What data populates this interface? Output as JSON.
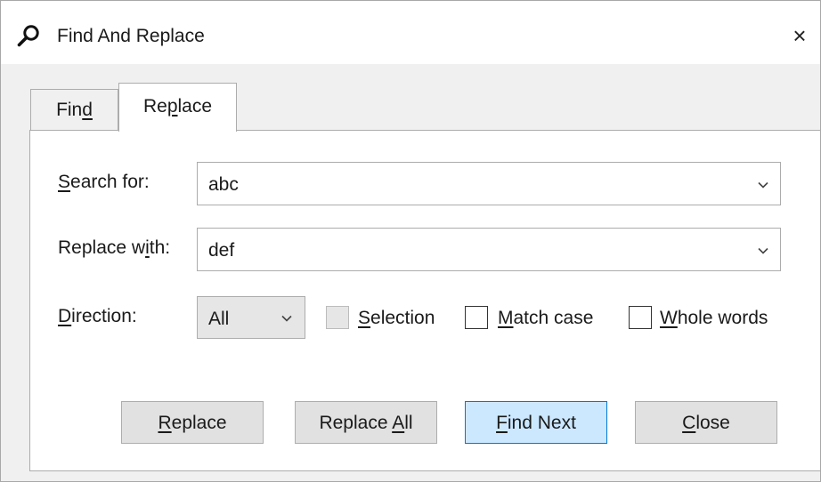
{
  "window": {
    "title": "Find And Replace",
    "close_glyph": "×",
    "title_icon": "search-icon"
  },
  "tabs": [
    {
      "label": "Find",
      "access_key_index": 3,
      "active": false
    },
    {
      "label": "Replace",
      "access_key_index": 2,
      "active": true
    }
  ],
  "form": {
    "search_label": "Search for:",
    "search_access_key_index": 0,
    "search_value": "abc",
    "replace_label": "Replace with:",
    "replace_access_key_index": 9,
    "replace_value": "def",
    "direction_label": "Direction:",
    "direction_access_key_index": 0,
    "direction_value": "All"
  },
  "options": [
    {
      "label": "Selection",
      "access_key_index": 0,
      "checked": false,
      "enabled": false
    },
    {
      "label": "Match case",
      "access_key_index": 0,
      "checked": false,
      "enabled": true
    },
    {
      "label": "Whole words",
      "access_key_index": 0,
      "checked": false,
      "enabled": true
    }
  ],
  "buttons": [
    {
      "label": "Replace",
      "access_key_index": 0,
      "default": false
    },
    {
      "label": "Replace All",
      "access_key_index": 8,
      "default": false
    },
    {
      "label": "Find Next",
      "access_key_index": 0,
      "default": true
    },
    {
      "label": "Close",
      "access_key_index": 0,
      "default": false
    }
  ],
  "colors": {
    "default_button_bg": "#cce8ff",
    "default_button_border": "#0078d7",
    "button_bg": "#e1e1e1",
    "dialog_bg": "#f0f0f0"
  }
}
